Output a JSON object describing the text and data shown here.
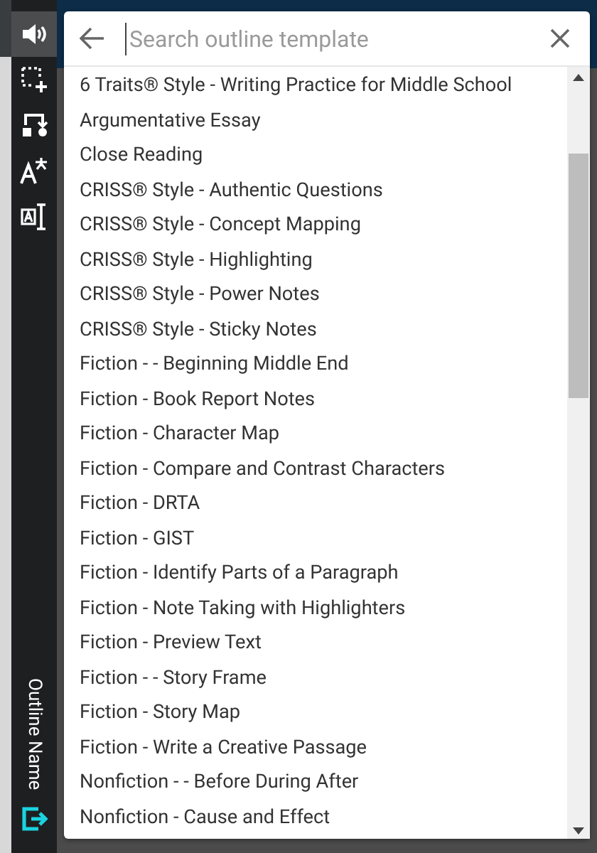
{
  "toolbar": {
    "tools": [
      {
        "kind": "speaker",
        "selected": true
      },
      {
        "kind": "select-add",
        "selected": false
      },
      {
        "kind": "flow",
        "selected": false
      },
      {
        "kind": "translate",
        "selected": false
      },
      {
        "kind": "text-box",
        "selected": false
      }
    ],
    "outline_label": "Outline Name"
  },
  "search": {
    "placeholder": "Search outline template"
  },
  "templates": [
    "6 Traits® Style - Writing Practice for Middle School",
    "Argumentative Essay",
    "Close Reading",
    "CRISS® Style - Authentic Questions",
    "CRISS® Style - Concept Mapping",
    "CRISS® Style - Highlighting",
    "CRISS® Style - Power Notes",
    "CRISS® Style - Sticky Notes",
    "Fiction - - Beginning Middle End",
    "Fiction - Book Report Notes",
    "Fiction - Character Map",
    "Fiction - Compare and Contrast Characters",
    "Fiction - DRTA",
    "Fiction - GIST",
    "Fiction - Identify Parts of a Paragraph",
    "Fiction - Note Taking with Highlighters",
    "Fiction - Preview Text",
    "Fiction - - Story Frame",
    "Fiction - Story Map",
    "Fiction - Write a Creative Passage",
    "Nonfiction - - Before During After",
    "Nonfiction - Cause and Effect"
  ]
}
